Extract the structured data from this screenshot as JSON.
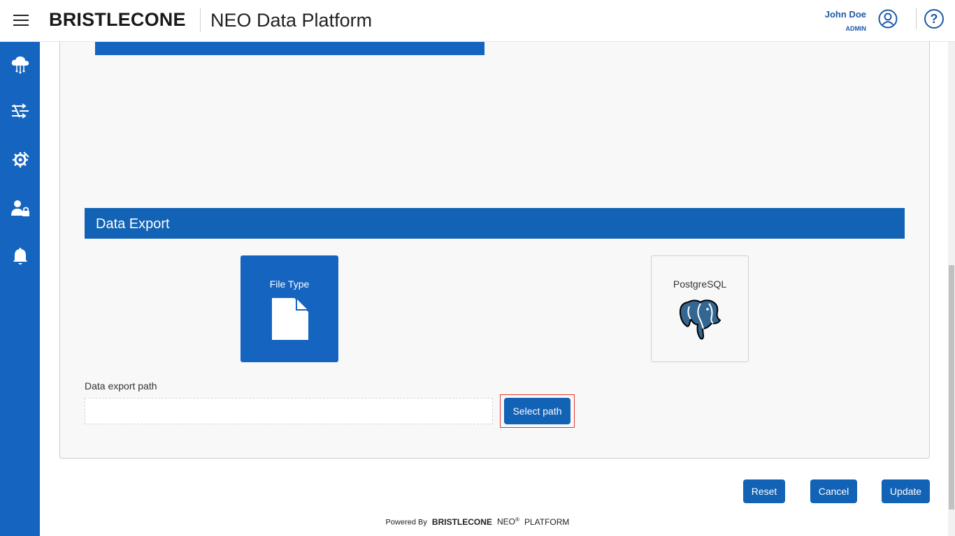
{
  "header": {
    "logo_text": "BRISTLECONE",
    "app_title": "NEO Data Platform",
    "user_name": "John Doe",
    "user_role": "ADMIN",
    "icons": [
      "menu-icon",
      "user-avatar-icon",
      "help-icon"
    ]
  },
  "sidebar": {
    "items": [
      {
        "icon": "cloud-network-icon"
      },
      {
        "icon": "flow-arrows-icon"
      },
      {
        "icon": "settings-tools-icon"
      },
      {
        "icon": "user-lock-icon"
      },
      {
        "icon": "bell-icon"
      }
    ]
  },
  "section": {
    "title": "Data Export"
  },
  "export_options": [
    {
      "label": "File Type",
      "icon": "file-icon",
      "selected": true
    },
    {
      "label": "PostgreSQL",
      "icon": "postgresql-elephant-icon",
      "selected": false
    }
  ],
  "path": {
    "label": "Data export path",
    "value": "",
    "select_button": "Select path"
  },
  "actions": {
    "reset": "Reset",
    "cancel": "Cancel",
    "update": "Update"
  },
  "footer": {
    "powered_by": "Powered By",
    "brand": "BRISTLECONE",
    "neo": "NEO",
    "reg": "®",
    "platform": "PLATFORM"
  },
  "colors": {
    "primary": "#1565c0",
    "header_text": "#1d5aa6",
    "focus_outline": "#e53935"
  }
}
